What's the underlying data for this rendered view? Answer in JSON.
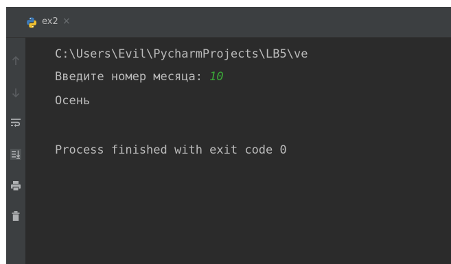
{
  "tab": {
    "label": "ex2",
    "close_glyph": "×",
    "icon": "python-icon"
  },
  "toolbar": {
    "items": [
      {
        "icon": "arrow-up-icon"
      },
      {
        "icon": "arrow-down-icon"
      },
      {
        "icon": "soft-wrap-icon"
      },
      {
        "icon": "scroll-to-end-icon"
      },
      {
        "icon": "print-icon"
      },
      {
        "icon": "trash-icon"
      }
    ]
  },
  "console": {
    "command_line": "C:\\Users\\Evil\\PycharmProjects\\LB5\\ve",
    "prompt_text": "Введите номер месяца: ",
    "user_input": "10",
    "output_line": "Осень",
    "exit_message": "Process finished with exit code 0"
  },
  "colors": {
    "background": "#2b2b2b",
    "panel": "#3c3f41",
    "text": "#bbbbbb",
    "user_input": "#3ba838",
    "disabled_icon": "#5a5d60",
    "icon": "#afb1b3"
  }
}
